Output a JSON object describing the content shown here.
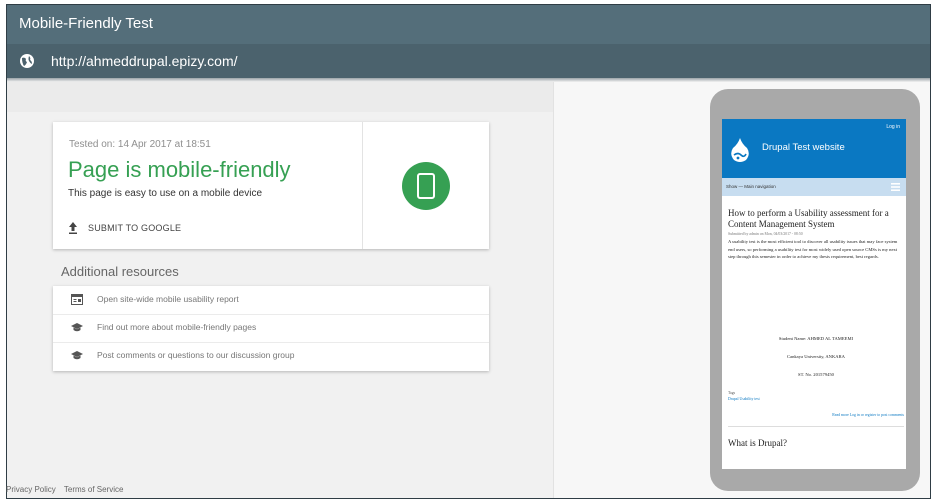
{
  "window": {
    "title": "Mobile-Friendly Test"
  },
  "urlbar": {
    "url": "http://ahmeddrupal.epizy.com/",
    "icon": "globe-icon"
  },
  "result": {
    "tested_on": "Tested on: 14 Apr 2017 at 18:51",
    "headline": "Page is mobile-friendly",
    "subline": "This page is easy to use on a mobile device",
    "submit_label": "SUBMIT TO GOOGLE",
    "status_color": "#36a053"
  },
  "resources": {
    "title": "Additional resources",
    "items": [
      {
        "label": "Open site-wide mobile usability report",
        "icon": "report-icon"
      },
      {
        "label": "Find out more about mobile-friendly pages",
        "icon": "graduation-cap-icon"
      },
      {
        "label": "Post comments or questions to our discussion group",
        "icon": "graduation-cap-icon"
      }
    ]
  },
  "footer": {
    "privacy": "Privacy Policy",
    "terms": "Terms of Service"
  },
  "preview": {
    "login": "Log in",
    "site_name": "Drupal Test website",
    "nav": "Show — Main navigation",
    "header_color": "#0a78c2",
    "article_title": "How to perform a Usability assessment for a Content Management System",
    "meta": "Submitted by admin on Mon, 04/03/2017 - 08:50",
    "body": "A usability test is the most efficient tool to discover all usability issues that may face system end users, so performing a usability test for most widely used open source CMSs is my next step through this semester in order to achieve my thesis requirement, best regards.",
    "student": "Student Name: AHMED AL TAMEEMI",
    "university": "Cankaya University, ANKARA",
    "student_no": "ST. No. 201579450",
    "tags_label": "Tags",
    "tags": "Drupal  Usability test",
    "read_more": "Read more   Log in or register to post comments",
    "next_title": "What is Drupal?"
  }
}
